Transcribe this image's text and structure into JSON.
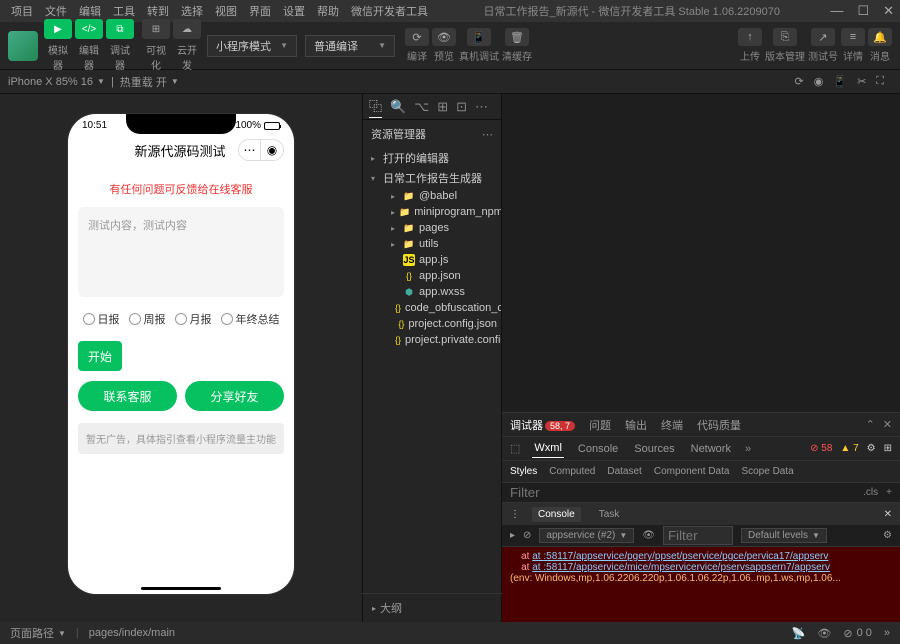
{
  "titlebar": {
    "menus": [
      "项目",
      "文件",
      "编辑",
      "工具",
      "转到",
      "选择",
      "视图",
      "界面",
      "设置",
      "帮助",
      "微信开发者工具"
    ],
    "project": "日常工作报告_新源代",
    "version": "微信开发者工具 Stable 1.06.2209070"
  },
  "toolbar": {
    "main_buttons": [
      {
        "icon": "▶",
        "label": "模拟器"
      },
      {
        "icon": "</>",
        "label": "编辑器"
      },
      {
        "icon": "⧉",
        "label": "调试器"
      }
    ],
    "gray_buttons": [
      {
        "icon": "⊞",
        "label": "可视化"
      },
      {
        "icon": "☁",
        "label": "云开发"
      }
    ],
    "dropdown1": "小程序模式",
    "dropdown2": "普通编译",
    "compile_actions": [
      {
        "icon": "⟳",
        "label": "编译"
      },
      {
        "icon": "👁",
        "label": "预览"
      },
      {
        "icon": "📱",
        "label": "真机调试"
      },
      {
        "icon": "🗑",
        "label": "清缓存"
      }
    ],
    "right_actions": [
      {
        "icon": "↑",
        "label": "上传"
      },
      {
        "icon": "⎘",
        "label": "版本管理"
      },
      {
        "icon": "↗",
        "label": "测试号"
      },
      {
        "icon": "≡",
        "label": "详情"
      },
      {
        "icon": "🔔",
        "label": "消息"
      }
    ]
  },
  "devicebar": {
    "device": "iPhone X 85% 16",
    "hotreload": "热重载 开"
  },
  "phone": {
    "time": "10:51",
    "battery": "100%",
    "nav_title": "新源代源码测试",
    "red_tip": "有任何问题可反馈给在线客服",
    "textarea_placeholder": "测试内容，测试内容",
    "radios": [
      "日报",
      "周报",
      "月报",
      "年终总结"
    ],
    "start": "开始",
    "contact": "联系客服",
    "share": "分享好友",
    "ad": "暂无广告，具体指引查看小程序流量主功能"
  },
  "explorer": {
    "title": "资源管理器",
    "sections": [
      "打开的编辑器",
      "日常工作报告生成器"
    ],
    "tree": [
      {
        "name": "@babel",
        "type": "folder",
        "depth": 2
      },
      {
        "name": "miniprogram_npm",
        "type": "folder",
        "depth": 2
      },
      {
        "name": "pages",
        "type": "folder-red",
        "depth": 2
      },
      {
        "name": "utils",
        "type": "folder-green",
        "depth": 2
      },
      {
        "name": "app.js",
        "type": "js",
        "depth": 2
      },
      {
        "name": "app.json",
        "type": "json",
        "depth": 2
      },
      {
        "name": "app.wxss",
        "type": "wxss",
        "depth": 2
      },
      {
        "name": "code_obfuscation_conf...",
        "type": "json",
        "depth": 2
      },
      {
        "name": "project.config.json",
        "type": "json",
        "depth": 2
      },
      {
        "name": "project.private.config.js...",
        "type": "json",
        "depth": 2
      }
    ],
    "outline": "大纲"
  },
  "bottom": {
    "panel_tabs": [
      "调试器",
      "问题",
      "输出",
      "终端",
      "代码质量"
    ],
    "debug_badge": "58, 7",
    "dev_tabs": [
      "Wxml",
      "Console",
      "Sources",
      "Network"
    ],
    "errors": "58",
    "warnings": "7",
    "style_tabs": [
      "Styles",
      "Computed",
      "Dataset",
      "Component Data",
      "Scope Data"
    ],
    "filter_placeholder": "Filter",
    "cls": ".cls",
    "console_tabs": [
      "Console",
      "Task"
    ],
    "context": "appservice (#2)",
    "filter2_placeholder": "Filter",
    "levels": "Default levels",
    "console_lines": [
      "at :58117/appservice/pgery/ppset/pservice/pgce/pervica17/appserv",
      "at :58117/appservice/mice/mpservicervice/pservsappsern7/appserv"
    ],
    "env_line": "(env: Windows,mp,1.06.2206.220p,1.06.1.06.22p,1.06..mp,1.ws,mp,1.06..."
  },
  "statusbar": {
    "path_label": "页面路径",
    "path": "pages/index/main",
    "counts": "0  0"
  }
}
